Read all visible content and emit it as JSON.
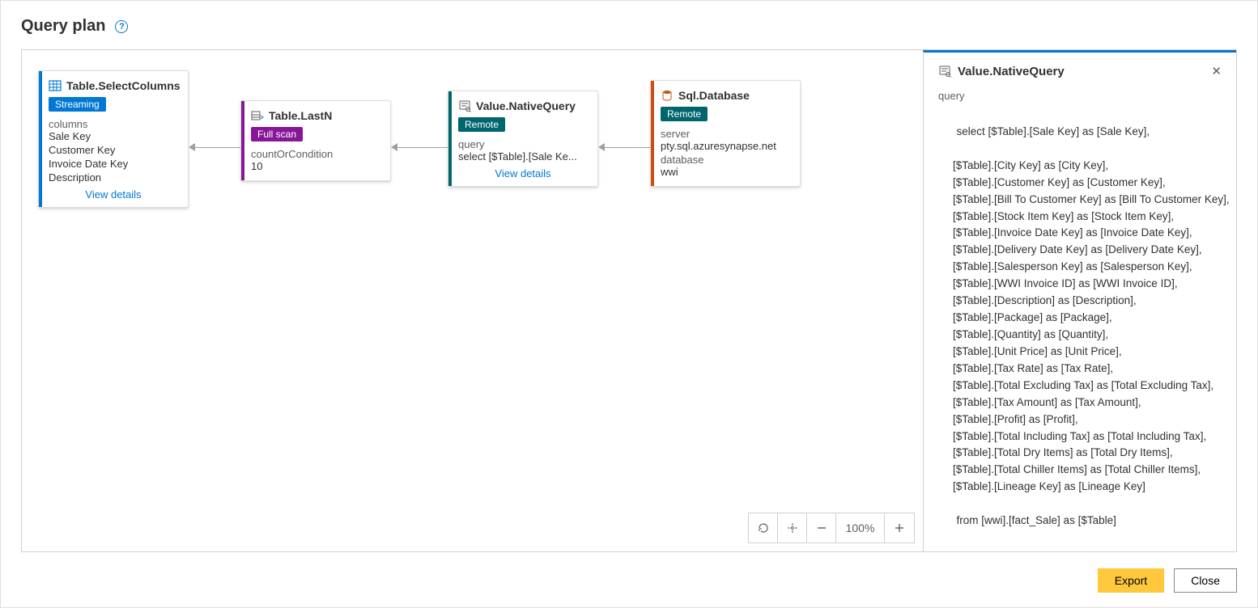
{
  "header": {
    "title": "Query plan"
  },
  "nodes": {
    "select": {
      "title": "Table.SelectColumns",
      "badge": "Streaming",
      "label_columns": "columns",
      "col1": "Sale Key",
      "col2": "Customer Key",
      "col3": "Invoice Date Key",
      "col4": "Description",
      "view": "View details"
    },
    "lastn": {
      "title": "Table.LastN",
      "badge": "Full scan",
      "label": "countOrCondition",
      "value": "10"
    },
    "native": {
      "title": "Value.NativeQuery",
      "badge": "Remote",
      "label": "query",
      "value": "select [$Table].[Sale Ke...",
      "view": "View details"
    },
    "sql": {
      "title": "Sql.Database",
      "badge": "Remote",
      "label_server": "server",
      "server": "pty.sql.azuresynapse.net",
      "label_db": "database",
      "db": "wwi"
    }
  },
  "zoom": {
    "pct": "100%"
  },
  "detail": {
    "title": "Value.NativeQuery",
    "label_query": "query",
    "sql_head": "select [$Table].[Sale Key] as [Sale Key],",
    "sql_lines": [
      "[$Table].[City Key] as [City Key],",
      "[$Table].[Customer Key] as [Customer Key],",
      "[$Table].[Bill To Customer Key] as [Bill To Customer Key],",
      "[$Table].[Stock Item Key] as [Stock Item Key],",
      "[$Table].[Invoice Date Key] as [Invoice Date Key],",
      "[$Table].[Delivery Date Key] as [Delivery Date Key],",
      "[$Table].[Salesperson Key] as [Salesperson Key],",
      "[$Table].[WWI Invoice ID] as [WWI Invoice ID],",
      "[$Table].[Description] as [Description],",
      "[$Table].[Package] as [Package],",
      "[$Table].[Quantity] as [Quantity],",
      "[$Table].[Unit Price] as [Unit Price],",
      "[$Table].[Tax Rate] as [Tax Rate],",
      "[$Table].[Total Excluding Tax] as [Total Excluding Tax],",
      "[$Table].[Tax Amount] as [Tax Amount],",
      "[$Table].[Profit] as [Profit],",
      "[$Table].[Total Including Tax] as [Total Including Tax],",
      "[$Table].[Total Dry Items] as [Total Dry Items],",
      "[$Table].[Total Chiller Items] as [Total Chiller Items],",
      "[$Table].[Lineage Key] as [Lineage Key]"
    ],
    "sql_from": "from [wwi].[fact_Sale] as [$Table]"
  },
  "buttons": {
    "export": "Export",
    "close": "Close"
  }
}
